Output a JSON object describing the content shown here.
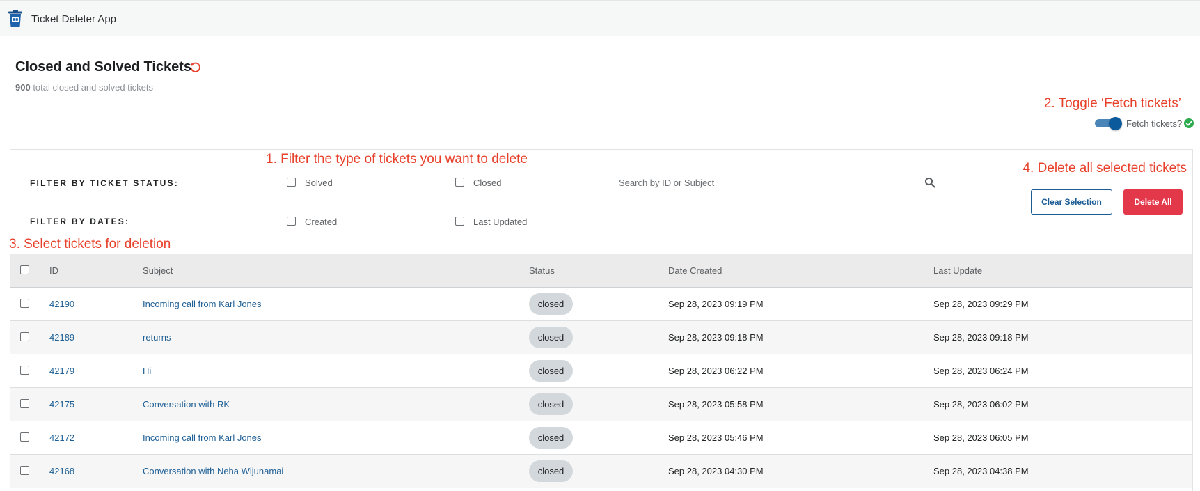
{
  "app": {
    "title": "Ticket Deleter App"
  },
  "header": {
    "title": "Closed and Solved Tickets",
    "count": "900",
    "count_suffix": " total closed and solved tickets"
  },
  "annotations": {
    "step1": "1. Filter the type of tickets you want to delete",
    "step2": "2. Toggle ‘Fetch tickets’",
    "step3": "3. Select tickets for deletion",
    "step4": "4. Delete all selected tickets"
  },
  "toggle": {
    "label": "Fetch tickets?",
    "on": true
  },
  "filters": {
    "status_label": "FILTER BY TICKET STATUS:",
    "dates_label": "FILTER BY DATES:",
    "status_options": [
      "Solved",
      "Closed"
    ],
    "date_options": [
      "Created",
      "Last Updated"
    ]
  },
  "search": {
    "placeholder": "Search by ID or Subject",
    "value": ""
  },
  "buttons": {
    "clear": "Clear Selection",
    "delete_all": "Delete All"
  },
  "table": {
    "columns": [
      "ID",
      "Subject",
      "Status",
      "Date Created",
      "Last Update"
    ],
    "rows": [
      {
        "id": "42190",
        "subject": "Incoming call from Karl Jones",
        "status": "closed",
        "created": "Sep 28, 2023 09:19 PM",
        "updated": "Sep 28, 2023 09:29 PM"
      },
      {
        "id": "42189",
        "subject": "returns",
        "status": "closed",
        "created": "Sep 28, 2023 09:18 PM",
        "updated": "Sep 28, 2023 09:18 PM"
      },
      {
        "id": "42179",
        "subject": "Hi",
        "status": "closed",
        "created": "Sep 28, 2023 06:22 PM",
        "updated": "Sep 28, 2023 06:24 PM"
      },
      {
        "id": "42175",
        "subject": "Conversation with RK",
        "status": "closed",
        "created": "Sep 28, 2023 05:58 PM",
        "updated": "Sep 28, 2023 06:02 PM"
      },
      {
        "id": "42172",
        "subject": "Incoming call from Karl Jones",
        "status": "closed",
        "created": "Sep 28, 2023 05:46 PM",
        "updated": "Sep 28, 2023 06:05 PM"
      },
      {
        "id": "42168",
        "subject": "Conversation with Neha Wijunamai",
        "status": "closed",
        "created": "Sep 28, 2023 04:30 PM",
        "updated": "Sep 28, 2023 04:38 PM"
      }
    ]
  },
  "colors": {
    "accent": "#1b5c95",
    "danger": "#e3384a",
    "annotation": "#e8412b",
    "success": "#2eaa4f"
  }
}
